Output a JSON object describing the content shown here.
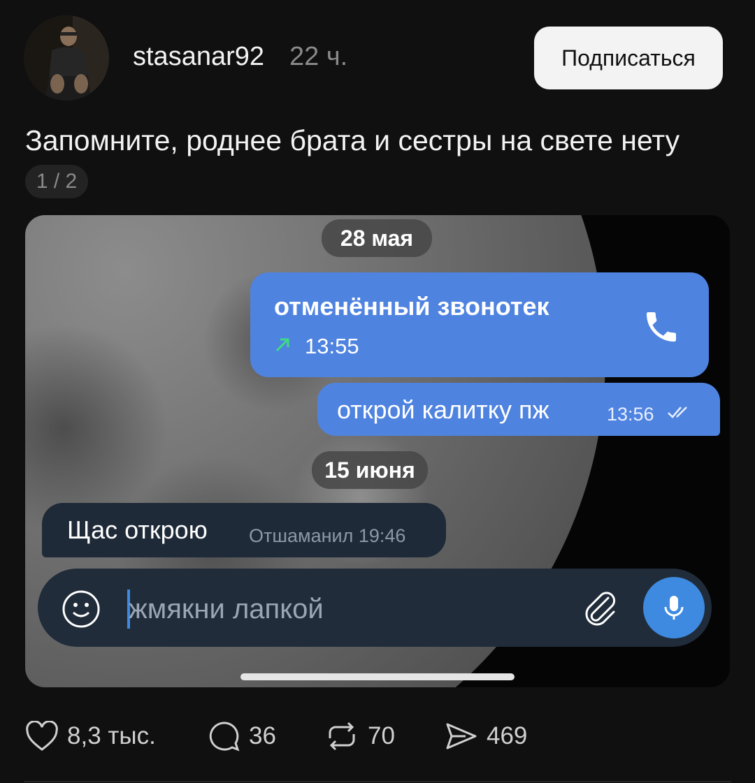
{
  "post": {
    "username": "stasanar92",
    "time": "22 ч.",
    "follow_label": "Подписаться",
    "caption": "Запомните, роднее брата и сестры на свете нету",
    "counter": "1 / 2"
  },
  "chat": {
    "date1": "28 мая",
    "call_text": "отменённый звонотек",
    "call_time": "13:55",
    "msg_out": "открой калитку пж",
    "msg_out_time": "13:56",
    "date2": "15 июня",
    "msg_in": "Щас открою",
    "msg_in_meta": "Отшаманил 19:46",
    "input_placeholder": "жмякни лапкой",
    "colors": {
      "outgoing": "#4f83e0",
      "call_arrow": "#3ddc84",
      "mic": "#3d8ae0"
    }
  },
  "actions": {
    "likes": "8,3 тыс.",
    "comments": "36",
    "reposts": "70",
    "shares": "469"
  }
}
